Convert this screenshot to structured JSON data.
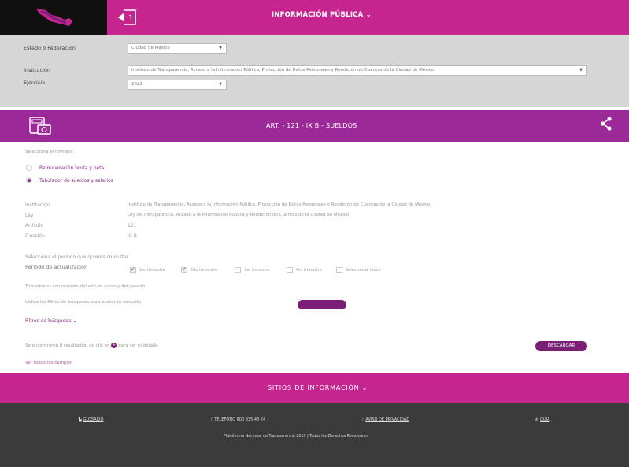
{
  "header": {
    "title": "INFORMACIÓN PÚBLICA",
    "title_caret": "⌄",
    "accent": "#c6258f"
  },
  "filters": {
    "estado_label": "Estado o Federación",
    "estado_value": "Ciudad de México",
    "institucion_label": "Institución",
    "institucion_value": "Instituto de Transparencia, Acceso a la Información Pública, Protección de Datos Personales y Rendición de Cuentas de la Ciudad de México",
    "ejercicio_label": "Ejercicio",
    "ejercicio_value": "2022"
  },
  "section": {
    "title": "ART. - 121 - IX B - SUELDOS",
    "color": "#9b2a98"
  },
  "formato": {
    "prompt": "Selecciona el formato:",
    "options": [
      "Remuneración bruta y neta",
      "Tabulador de sueldos y salarios"
    ],
    "selected_index": 1
  },
  "info": {
    "institucion_label": "Institución",
    "institucion_value": "Instituto de Transparencia, Acceso a la Información Pública, Protección de Datos Personales y Rendición de Cuentas de la Ciudad de México",
    "ley_label": "Ley",
    "ley_value": "Ley de Transparencia, Acceso a la Información Pública y Rendición de Cuentas de la Ciudad de México",
    "articulo_label": "Artículo",
    "articulo_value": "121",
    "fraccion_label": "Fracción",
    "fraccion_value": "IX B"
  },
  "periodo": {
    "prompt": "Selecciona el periodo que quieres consultar",
    "label": "Periodo de actualización",
    "options": [
      {
        "label": "1er trimestre",
        "checked": true
      },
      {
        "label": "2do trimestre",
        "checked": true
      },
      {
        "label": "3er trimestre",
        "checked": false
      },
      {
        "label": "4to trimestre",
        "checked": false
      },
      {
        "label": "Seleccionar todos",
        "checked": false
      }
    ]
  },
  "notes": {
    "trimestres": "Trimestre(s) con revisión del año en curso y del pasado",
    "filtros_hint": "Utiliza los filtros de búsqueda para acotar tu consulta",
    "filtros_toggle": "Filtros de búsqueda ⌄",
    "results": "Se encontraron 8 resultados, da clic en",
    "results_suffix": "para ver el detalle.",
    "ver_todos": "Ver todos los campos"
  },
  "buttons": {
    "descargar": "DESCARGAR"
  },
  "sitios": {
    "title": "SITIOS DE INFORMACIÓN",
    "caret": "⌄"
  },
  "footer": {
    "glosario": "GLOSARIO",
    "telefono": "TELÉFONO 800 835 43 24",
    "aviso": "AVISO DE PRIVACIDAD",
    "guia": "GUÍA",
    "copyright": "Plataforma Nacional de Transparencia 2019 | Todos los Derechos Reservados"
  }
}
